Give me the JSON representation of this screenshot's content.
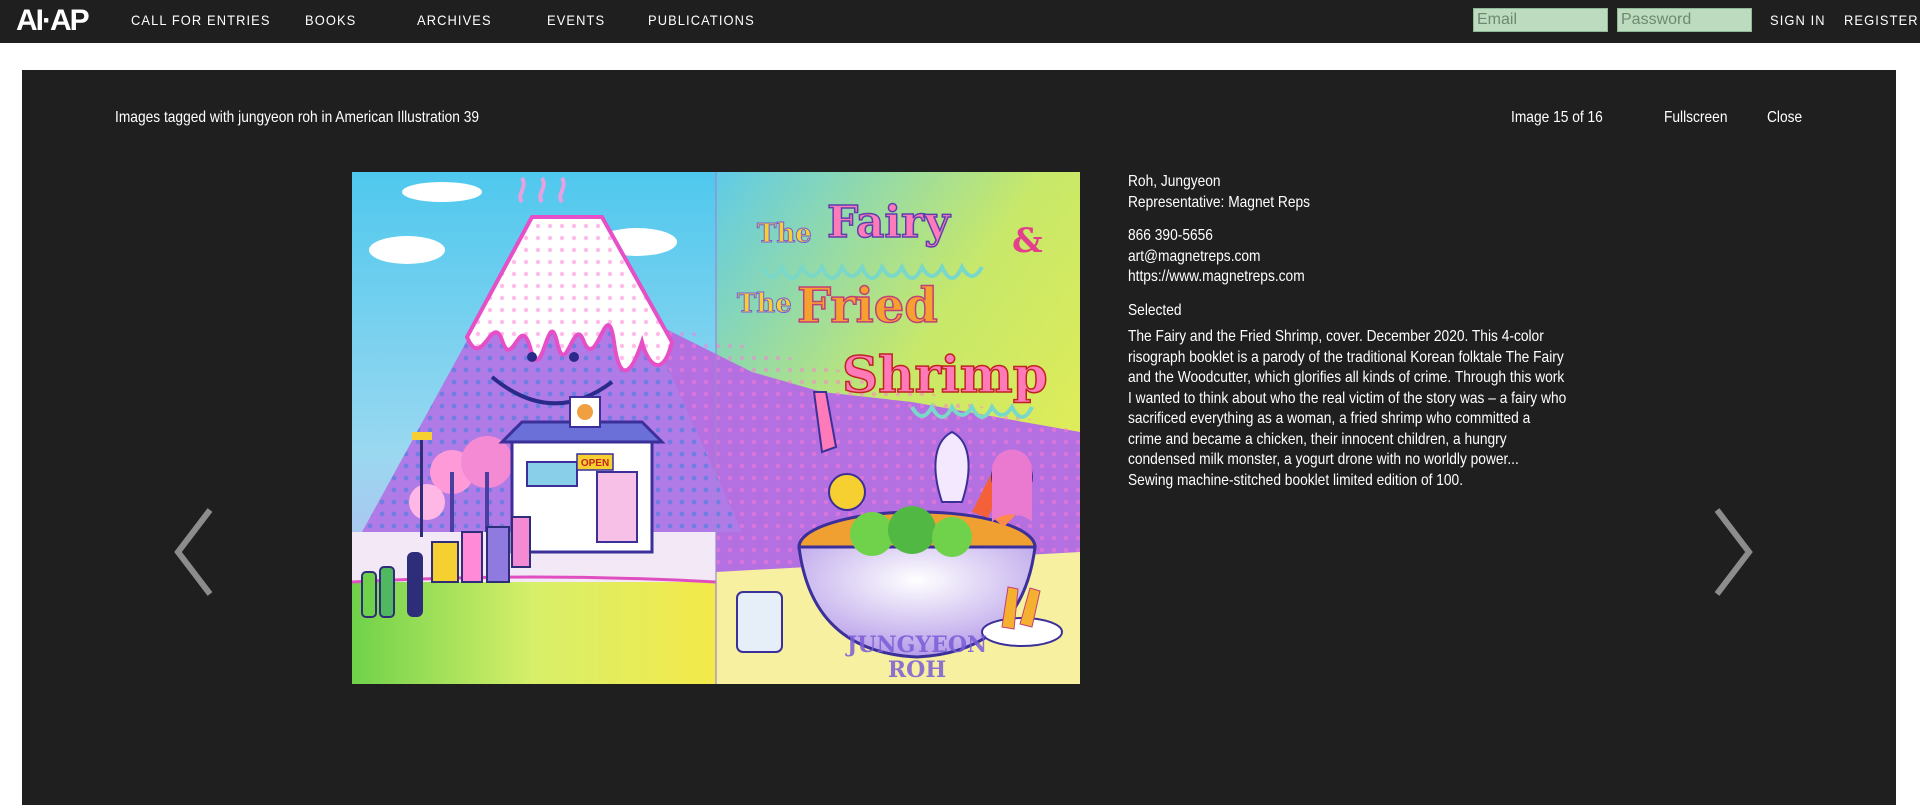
{
  "header": {
    "logo": "AI·AP",
    "nav": [
      {
        "label": "CALL FOR ENTRIES"
      },
      {
        "label": "BOOKS"
      },
      {
        "label": "ARCHIVES"
      },
      {
        "label": "EVENTS"
      },
      {
        "label": "PUBLICATIONS"
      }
    ],
    "email_placeholder": "Email",
    "password_placeholder": "Password",
    "sign_in": "SIGN IN",
    "register": "REGISTER"
  },
  "lightbox": {
    "caption": "Images tagged with jungyeon roh in American Illustration 39",
    "counter": "Image 15 of 16",
    "fullscreen": "Fullscreen",
    "close": "Close",
    "prev_icon": "chevron-left-icon",
    "next_icon": "chevron-right-icon"
  },
  "artwork": {
    "title_lines": [
      "The",
      "Fairy",
      "&",
      "The",
      "Fried",
      "Shrimp"
    ],
    "sign": "OPEN",
    "credit_lines": [
      "JUNGYEON",
      "ROH"
    ]
  },
  "artist": {
    "name": "Roh, Jungyeon",
    "representative": "Representative: Magnet Reps",
    "phone": "866 390-5656",
    "email": "art@magnetreps.com",
    "website": "https://www.magnetreps.com",
    "status": "Selected",
    "description": "The Fairy and the Fried Shrimp, cover. December 2020. This 4-color risograph booklet is a parody of the traditional Korean folktale The Fairy and the Woodcutter, which glorifies all kinds of crime. Through this work I wanted to think about who the real victim of the story was – a fairy who sacrificed everything as a woman, a fried shrimp who committed a crime and became a chicken, their innocent children, a hungry condensed milk monster, a yogurt drone with no worldly power... Sewing machine-stitched booklet limited edition of 100."
  },
  "colors": {
    "bar_bg": "#1f1f1f",
    "input_bg": "#bddcbf",
    "text": "#ffffff",
    "arrow": "#8c8c8c"
  }
}
